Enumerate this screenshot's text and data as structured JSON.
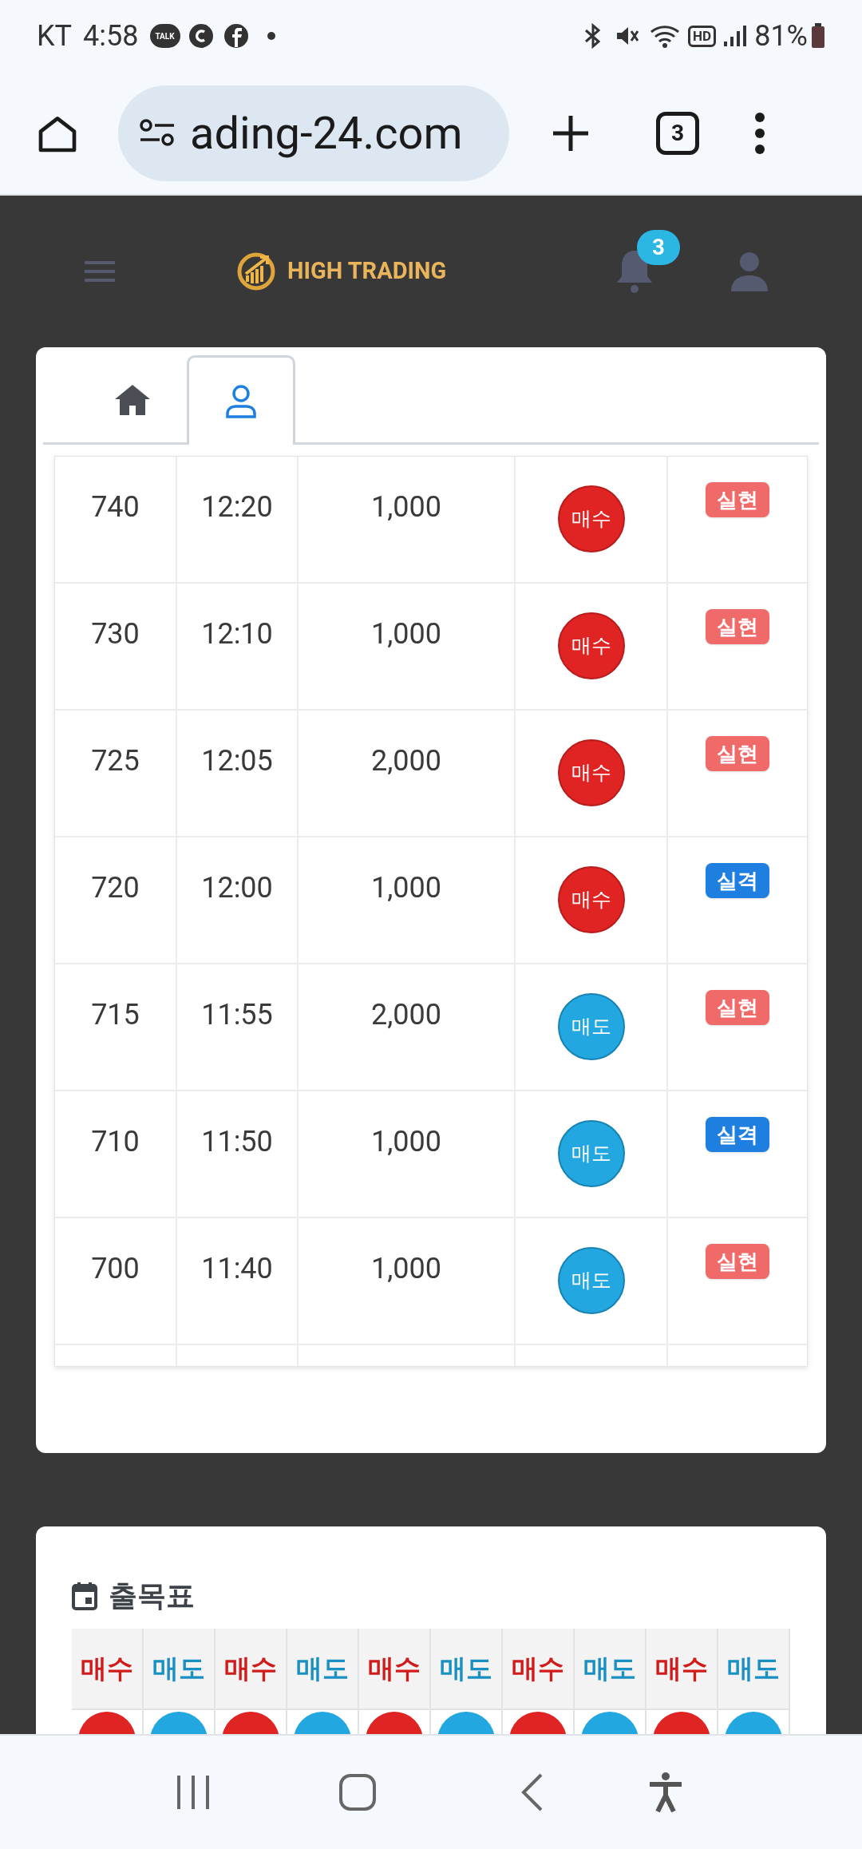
{
  "status_bar": {
    "carrier": "KT",
    "time": "4:58",
    "talk_icon_text": "TALK",
    "hd_text": "HD",
    "battery": "81%"
  },
  "browser": {
    "url": "ading-24.com",
    "tab_count": "3"
  },
  "header": {
    "logo": "HIGH TRADING",
    "notification_count": "3"
  },
  "tabs": [
    {
      "kind": "home",
      "selected": false
    },
    {
      "kind": "user",
      "selected": true
    }
  ],
  "trades": [
    {
      "number": "740",
      "time": "12:20",
      "amount": "1,000",
      "side": {
        "label": "매수",
        "kind": "buy"
      },
      "result": {
        "label": "실현",
        "kind": "hit"
      }
    },
    {
      "number": "730",
      "time": "12:10",
      "amount": "1,000",
      "side": {
        "label": "매수",
        "kind": "buy"
      },
      "result": {
        "label": "실현",
        "kind": "hit"
      }
    },
    {
      "number": "725",
      "time": "12:05",
      "amount": "2,000",
      "side": {
        "label": "매수",
        "kind": "buy"
      },
      "result": {
        "label": "실현",
        "kind": "hit"
      }
    },
    {
      "number": "720",
      "time": "12:00",
      "amount": "1,000",
      "side": {
        "label": "매수",
        "kind": "buy"
      },
      "result": {
        "label": "실격",
        "kind": "miss"
      }
    },
    {
      "number": "715",
      "time": "11:55",
      "amount": "2,000",
      "side": {
        "label": "매도",
        "kind": "sell"
      },
      "result": {
        "label": "실현",
        "kind": "hit"
      }
    },
    {
      "number": "710",
      "time": "11:50",
      "amount": "1,000",
      "side": {
        "label": "매도",
        "kind": "sell"
      },
      "result": {
        "label": "실격",
        "kind": "miss"
      }
    },
    {
      "number": "700",
      "time": "11:40",
      "amount": "1,000",
      "side": {
        "label": "매도",
        "kind": "sell"
      },
      "result": {
        "label": "실현",
        "kind": "hit"
      }
    }
  ],
  "attendance": {
    "title": "출목표",
    "cells": [
      {
        "label": "매수",
        "kind": "buy"
      },
      {
        "label": "매도",
        "kind": "sell"
      },
      {
        "label": "매수",
        "kind": "buy"
      },
      {
        "label": "매도",
        "kind": "sell"
      },
      {
        "label": "매수",
        "kind": "buy"
      },
      {
        "label": "매도",
        "kind": "sell"
      },
      {
        "label": "매수",
        "kind": "buy"
      },
      {
        "label": "매도",
        "kind": "sell"
      },
      {
        "label": "매수",
        "kind": "buy"
      },
      {
        "label": "매도",
        "kind": "sell"
      }
    ]
  }
}
